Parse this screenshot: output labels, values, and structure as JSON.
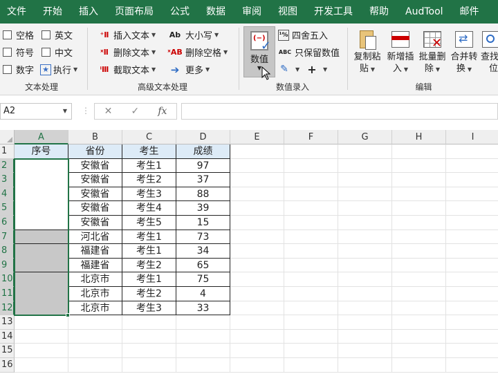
{
  "tabs": [
    "文件",
    "开始",
    "插入",
    "页面布局",
    "公式",
    "数据",
    "审阅",
    "视图",
    "开发工具",
    "帮助",
    "AudTool",
    "邮件"
  ],
  "ribbon": {
    "text_group": {
      "label": "文本处理",
      "checks": [
        [
          "空格",
          "英文"
        ],
        [
          "符号",
          "中文"
        ],
        [
          "数字",
          "执行"
        ]
      ]
    },
    "advanced_group": {
      "label": "高级文本处理",
      "insert": "插入文本",
      "delete": "删除文本",
      "extract": "截取文本",
      "case": "大小写",
      "delete_space": "删除空格",
      "more": "更多"
    },
    "number_group": {
      "label": "数值录入",
      "value_btn": "数值",
      "round": "四舍五入",
      "keep_value": "只保留数值"
    },
    "edit_group": {
      "label": "编辑",
      "copy_paste": [
        "复制粘",
        "贴"
      ],
      "insert_new": [
        "新增插",
        "入"
      ],
      "batch_delete": [
        "批量删",
        "除"
      ],
      "merge_convert": [
        "合并转",
        "换"
      ],
      "find": [
        "查找",
        "位"
      ]
    }
  },
  "formula_bar": {
    "name_box": "A2",
    "content": ""
  },
  "columns": [
    "A",
    "B",
    "C",
    "D",
    "E",
    "F",
    "G",
    "H",
    "I"
  ],
  "rows": [
    "1",
    "2",
    "3",
    "4",
    "5",
    "6",
    "7",
    "8",
    "9",
    "10",
    "11",
    "12",
    "13",
    "14",
    "15",
    "16"
  ],
  "table": {
    "headers": [
      "序号",
      "省份",
      "考生",
      "成绩"
    ],
    "data": [
      [
        "",
        "安徽省",
        "考生1",
        "97"
      ],
      [
        "",
        "安徽省",
        "考生2",
        "37"
      ],
      [
        "",
        "安徽省",
        "考生3",
        "88"
      ],
      [
        "",
        "安徽省",
        "考生4",
        "39"
      ],
      [
        "",
        "安徽省",
        "考生5",
        "15"
      ],
      [
        "",
        "河北省",
        "考生1",
        "73"
      ],
      [
        "",
        "福建省",
        "考生1",
        "34"
      ],
      [
        "",
        "福建省",
        "考生2",
        "65"
      ],
      [
        "",
        "北京市",
        "考生1",
        "75"
      ],
      [
        "",
        "北京市",
        "考生2",
        "4"
      ],
      [
        "",
        "北京市",
        "考生3",
        "33"
      ]
    ]
  },
  "colors": {
    "brand": "#217346",
    "header_fill": "#ddebf7",
    "merged_fill": "#c8c8c8"
  }
}
